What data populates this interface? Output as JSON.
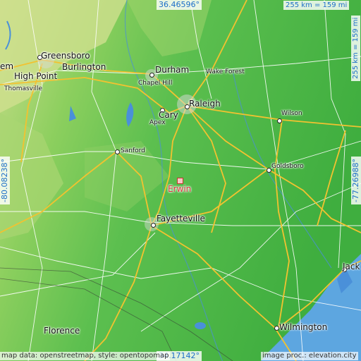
{
  "map": {
    "center_label": "Erwin",
    "coordinates": {
      "north": "36.46596°",
      "south": "34.17142°",
      "west": "-80.08238°",
      "east": "-77.26988°"
    },
    "scale": {
      "horizontal": "255 km = 159 mi",
      "vertical": "255 km = 159 mi"
    },
    "credits": {
      "left": "map data: openstreetmap, style: opentopomap",
      "right": "image proc.: elevation.city"
    },
    "colors": {
      "lowland": "#3fae3f",
      "upland": "#8ccf5e",
      "highland": "#c9dd8a",
      "water": "#4a90d9",
      "ocean": "#5da6e0",
      "highway": "#f2c230",
      "road": "#ffffff",
      "marker": "#d9343a"
    },
    "cities": [
      {
        "label": "Greensboro",
        "size": "big"
      },
      {
        "label": "Burlington",
        "size": "big"
      },
      {
        "label": "High Point",
        "size": "big"
      },
      {
        "label": "Thomasville",
        "size": "small"
      },
      {
        "label": "Durham",
        "size": "big"
      },
      {
        "label": "Wake Forest",
        "size": "small"
      },
      {
        "label": "Chapel Hill",
        "size": "small"
      },
      {
        "label": "Raleigh",
        "size": "big"
      },
      {
        "label": "Cary",
        "size": "big"
      },
      {
        "label": "Apex",
        "size": "small"
      },
      {
        "label": "Wilson",
        "size": "small"
      },
      {
        "label": "Sanford",
        "size": "small"
      },
      {
        "label": "Goldsboro",
        "size": "small"
      },
      {
        "label": "Fayetteville",
        "size": "big"
      },
      {
        "label": "Jack",
        "size": "big"
      },
      {
        "label": "Florence",
        "size": "big"
      },
      {
        "label": "Wilmington",
        "size": "big"
      },
      {
        "label": "em",
        "size": "big"
      }
    ]
  }
}
